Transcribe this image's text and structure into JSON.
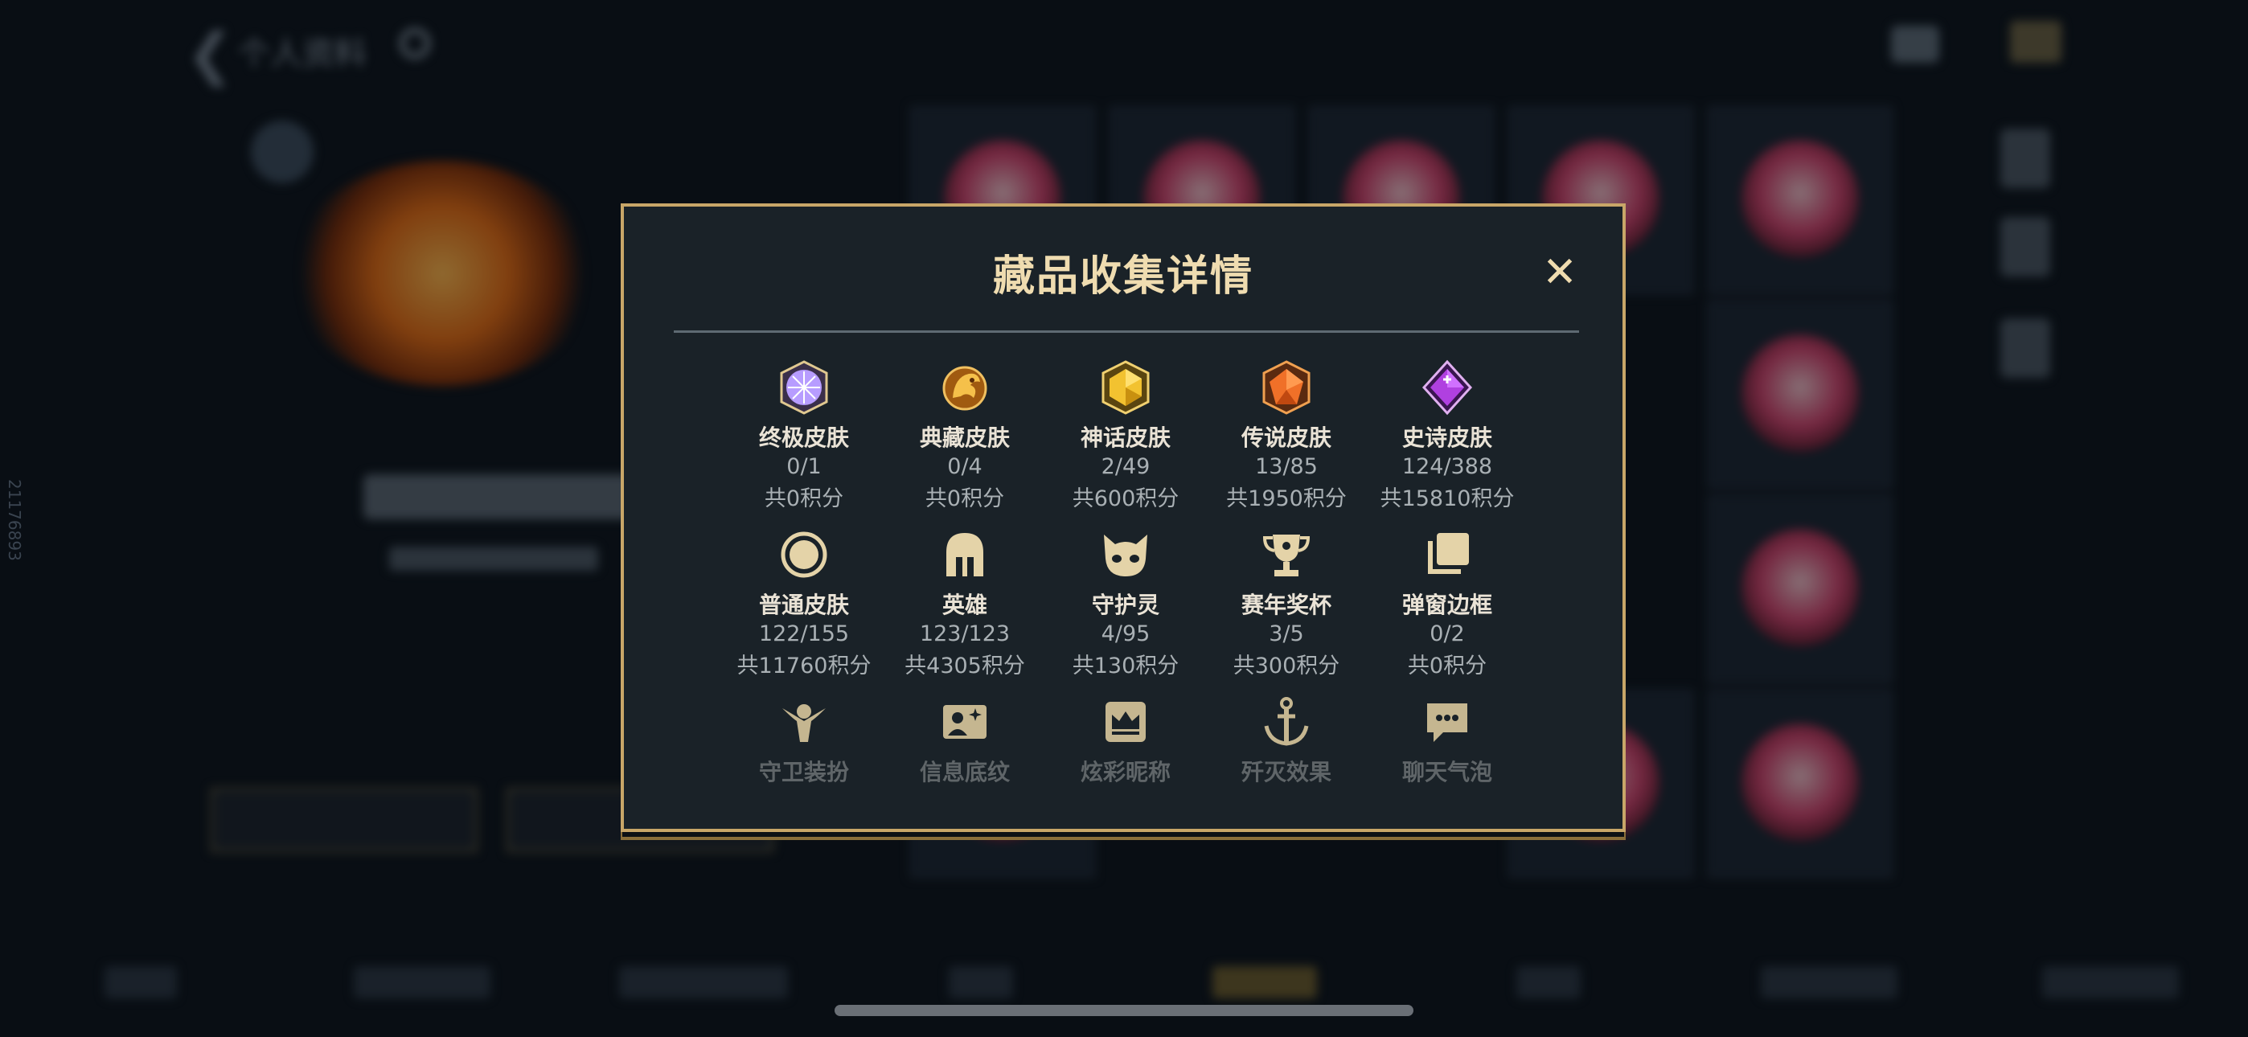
{
  "modal": {
    "title": "藏品收集详情",
    "close_icon": "✕"
  },
  "items": [
    {
      "name": "终极皮肤",
      "count": "0/1",
      "points": "共0积分",
      "icon": "ultimate-gem-icon",
      "color": "#c9b0ff"
    },
    {
      "name": "典藏皮肤",
      "count": "0/4",
      "points": "共0积分",
      "icon": "legendary-dragon-icon",
      "color": "#e8a53c"
    },
    {
      "name": "神话皮肤",
      "count": "2/49",
      "points": "共600积分",
      "icon": "mythic-gem-icon",
      "color": "#f2c230"
    },
    {
      "name": "传说皮肤",
      "count": "13/85",
      "points": "共1950积分",
      "icon": "legend-gem-icon",
      "color": "#f07028"
    },
    {
      "name": "史诗皮肤",
      "count": "124/388",
      "points": "共15810积分",
      "icon": "epic-gem-icon",
      "color": "#b040e0"
    },
    {
      "name": "普通皮肤",
      "count": "122/155",
      "points": "共11760积分",
      "icon": "ring-icon",
      "color": "#e4d3a8"
    },
    {
      "name": "英雄",
      "count": "123/123",
      "points": "共4305积分",
      "icon": "helmet-icon",
      "color": "#e4d3a8"
    },
    {
      "name": "守护灵",
      "count": "4/95",
      "points": "共130积分",
      "icon": "guardian-face-icon",
      "color": "#e4d3a8"
    },
    {
      "name": "赛年奖杯",
      "count": "3/5",
      "points": "共300积分",
      "icon": "trophy-icon",
      "color": "#e4d3a8"
    },
    {
      "name": "弹窗边框",
      "count": "0/2",
      "points": "共0积分",
      "icon": "frames-icon",
      "color": "#e4d3a8"
    },
    {
      "name": "守卫装扮",
      "icon": "guard-costume-icon",
      "color": "#d8c79c"
    },
    {
      "name": "信息底纹",
      "icon": "info-card-icon",
      "color": "#d8c79c"
    },
    {
      "name": "炫彩昵称",
      "icon": "crown-nameplate-icon",
      "color": "#d8c79c"
    },
    {
      "name": "歼灭效果",
      "icon": "anchor-icon",
      "color": "#d8c79c"
    },
    {
      "name": "聊天气泡",
      "icon": "chat-bubble-icon",
      "color": "#d8c79c"
    }
  ],
  "background": {
    "header_title": "个人资料",
    "back_icon": "❮",
    "side_id": "21176893"
  }
}
